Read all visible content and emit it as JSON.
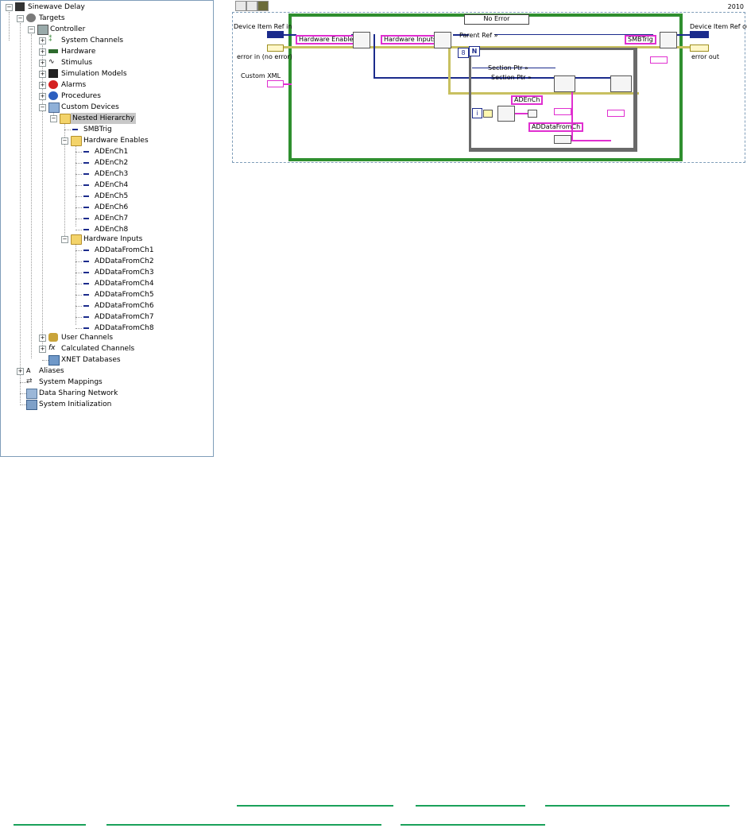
{
  "tree": {
    "items": [
      {
        "label": "Sinewave Delay",
        "level": 0
      },
      {
        "label": "Targets",
        "level": 1
      },
      {
        "label": "Controller",
        "level": 2
      },
      {
        "label": "System Channels",
        "level": 3
      },
      {
        "label": "Hardware",
        "level": 3
      },
      {
        "label": "Stimulus",
        "level": 3
      },
      {
        "label": "Simulation Models",
        "level": 3
      },
      {
        "label": "Alarms",
        "level": 3
      },
      {
        "label": "Procedures",
        "level": 3
      },
      {
        "label": "Custom Devices",
        "level": 3
      },
      {
        "label": "Nested Hierarchy",
        "level": 4,
        "selected": true
      },
      {
        "label": "SMBTrig",
        "level": 5
      },
      {
        "label": "Hardware Enables",
        "level": 5
      },
      {
        "label": "ADEnCh1",
        "level": 6
      },
      {
        "label": "ADEnCh2",
        "level": 6
      },
      {
        "label": "ADEnCh3",
        "level": 6
      },
      {
        "label": "ADEnCh4",
        "level": 6
      },
      {
        "label": "ADEnCh5",
        "level": 6
      },
      {
        "label": "ADEnCh6",
        "level": 6
      },
      {
        "label": "ADEnCh7",
        "level": 6
      },
      {
        "label": "ADEnCh8",
        "level": 6
      },
      {
        "label": "Hardware Inputs",
        "level": 5
      },
      {
        "label": "ADDataFromCh1",
        "level": 6
      },
      {
        "label": "ADDataFromCh2",
        "level": 6
      },
      {
        "label": "ADDataFromCh3",
        "level": 6
      },
      {
        "label": "ADDataFromCh4",
        "level": 6
      },
      {
        "label": "ADDataFromCh5",
        "level": 6
      },
      {
        "label": "ADDataFromCh6",
        "level": 6
      },
      {
        "label": "ADDataFromCh7",
        "level": 6
      },
      {
        "label": "ADDataFromCh8",
        "level": 6
      },
      {
        "label": "User Channels",
        "level": 3
      },
      {
        "label": "Calculated Channels",
        "level": 3
      },
      {
        "label": "XNET Databases",
        "level": 3
      },
      {
        "label": "Aliases",
        "level": 1
      },
      {
        "label": "System Mappings",
        "level": 1
      },
      {
        "label": "Data Sharing Network",
        "level": 1
      },
      {
        "label": "System Initialization",
        "level": 1
      }
    ]
  },
  "diagram": {
    "year": "2010",
    "case_selector": "No Error",
    "labels": {
      "device_ref_in": "Device Item Ref in",
      "error_in": "error in (no error)",
      "custom_xml": "Custom XML",
      "device_ref_out": "Device Item Ref out",
      "error_out": "error out",
      "parent_ref": "Parent Ref »",
      "section_ptr_1": "Section Ptr »",
      "section_ptr_2": "Section Ptr »"
    },
    "constants": {
      "hardware_enables": "Hardware Enables",
      "hardware_inputs": "Hardware Inputs",
      "smbtrig": "SMBTrig",
      "adench": "ADEnCh",
      "addatafromch": "ADDataFromCh",
      "loop_count": "8",
      "loop_n": "N",
      "loop_i": "i"
    }
  },
  "colors": {
    "string_wire": "#e02fd0",
    "error_wire": "#c8c060",
    "ref_wire": "#1b2b8c",
    "case_frame": "#2f8f2f",
    "link_underline": "#1aa15a"
  }
}
